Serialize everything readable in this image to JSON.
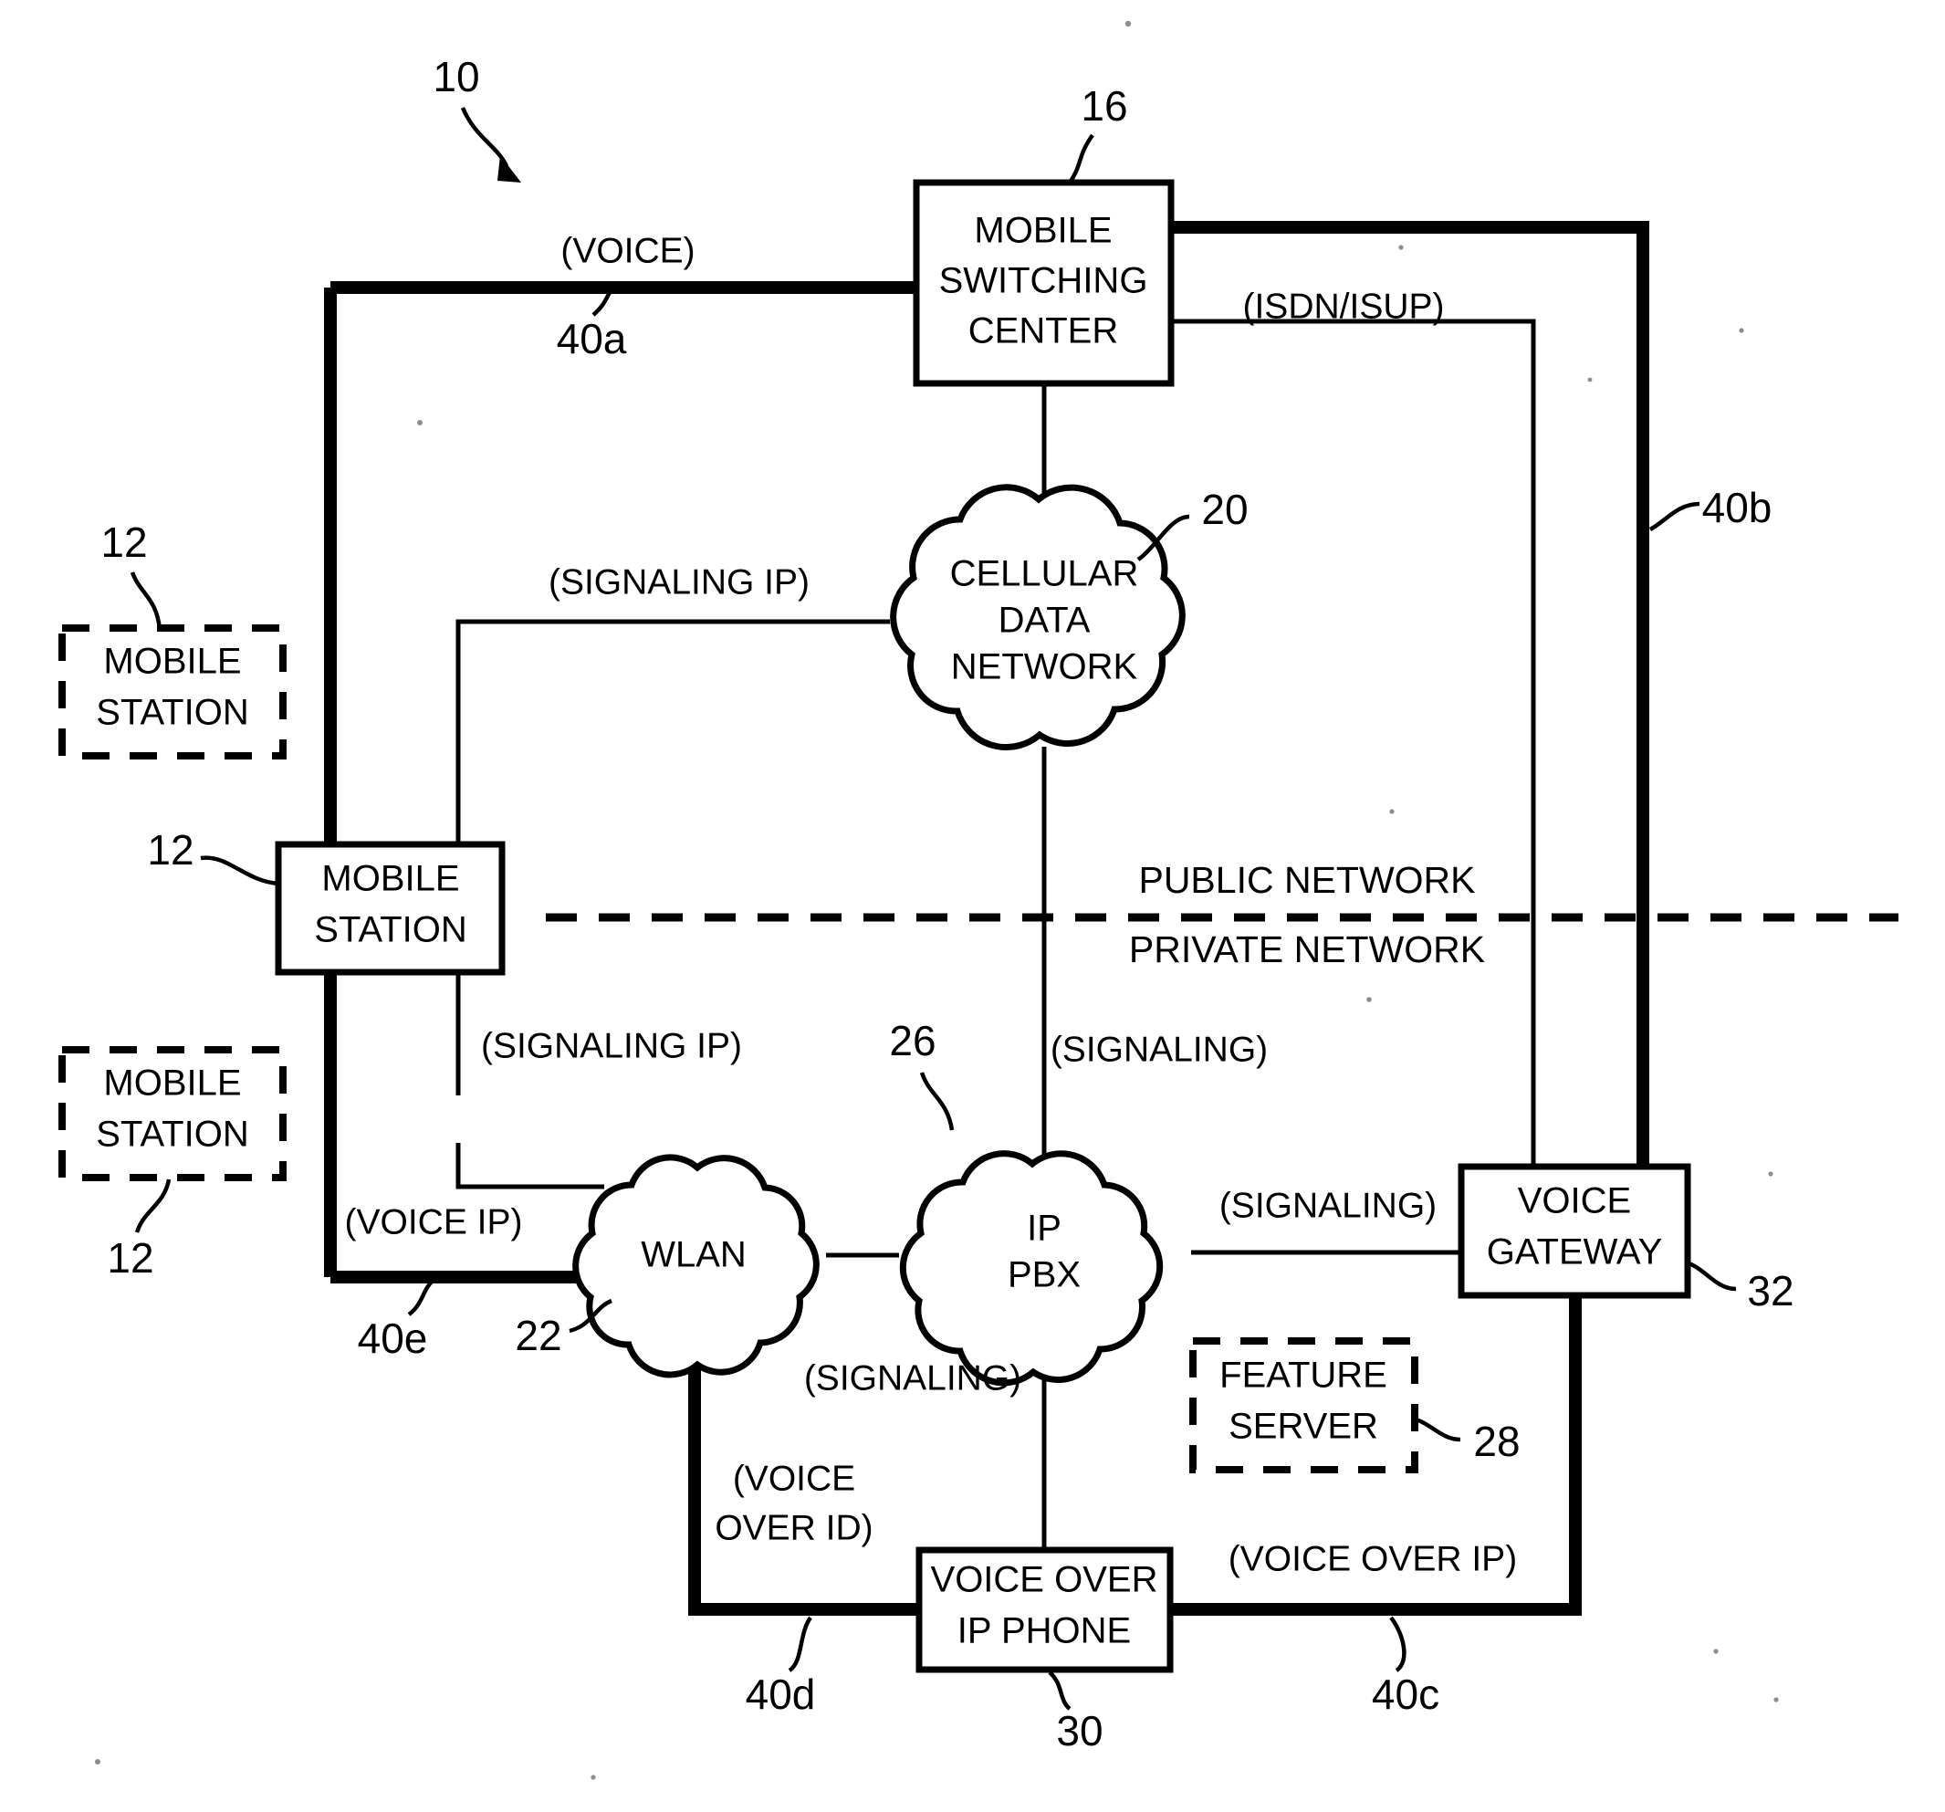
{
  "figure": {
    "ref": "10",
    "divider": {
      "public_label": "PUBLIC NETWORK",
      "private_label": "PRIVATE NETWORK"
    }
  },
  "nodes": {
    "mobile_station_top": {
      "line1": "MOBILE",
      "line2": "STATION",
      "ref": "12",
      "style": "dashed"
    },
    "mobile_station_mid": {
      "line1": "MOBILE",
      "line2": "STATION",
      "ref": "12",
      "style": "solid"
    },
    "mobile_station_bottom": {
      "line1": "MOBILE",
      "line2": "STATION",
      "ref": "12",
      "style": "dashed"
    },
    "mobile_switching_center": {
      "line1": "MOBILE",
      "line2": "SWITCHING",
      "line3": "CENTER",
      "ref": "16",
      "style": "solid"
    },
    "cellular_data_network": {
      "line1": "CELLULAR",
      "line2": "DATA",
      "line3": "NETWORK",
      "ref": "20",
      "style": "cloud"
    },
    "wlan": {
      "line1": "WLAN",
      "ref": "22",
      "style": "cloud"
    },
    "ip_pbx": {
      "line1": "IP",
      "line2": "PBX",
      "ref": "26",
      "style": "cloud"
    },
    "feature_server": {
      "line1": "FEATURE",
      "line2": "SERVER",
      "ref": "28",
      "style": "dashed"
    },
    "voice_over_ip_phone": {
      "line1": "VOICE OVER",
      "line2": "IP PHONE",
      "ref": "30",
      "style": "solid"
    },
    "voice_gateway": {
      "line1": "VOICE",
      "line2": "GATEWAY",
      "ref": "32",
      "style": "solid"
    }
  },
  "connections": [
    {
      "id": "voice_40a",
      "label": "(VOICE)",
      "ref": "40a",
      "weight": "thick"
    },
    {
      "id": "isdn_isup",
      "label": "(ISDN/ISUP)",
      "ref": "",
      "weight": "thin"
    },
    {
      "id": "bearer_40b",
      "label": "",
      "ref": "40b",
      "weight": "thick"
    },
    {
      "id": "signaling_ip_upper",
      "label": "(SIGNALING IP)",
      "ref": "",
      "weight": "thin"
    },
    {
      "id": "signaling_ip_lower",
      "label": "(SIGNALING IP)",
      "ref": "",
      "weight": "thin"
    },
    {
      "id": "voice_ip_40e",
      "label": "(VOICE IP)",
      "ref": "40e",
      "weight": "thick"
    },
    {
      "id": "signaling_cdn_pbx",
      "label": "(SIGNALING)",
      "ref": "",
      "weight": "thin"
    },
    {
      "id": "signaling_pbx_phone",
      "label": "(SIGNALING)",
      "ref": "",
      "weight": "thin"
    },
    {
      "id": "signaling_pbx_vgw",
      "label": "(SIGNALING)",
      "ref": "",
      "weight": "thin"
    },
    {
      "id": "voice_over_id_40d",
      "label_line1": "(VOICE",
      "label_line2": "OVER ID)",
      "ref": "40d",
      "weight": "thick"
    },
    {
      "id": "voice_over_ip_40c",
      "label": "(VOICE OVER IP)",
      "ref": "40c",
      "weight": "thick"
    }
  ]
}
